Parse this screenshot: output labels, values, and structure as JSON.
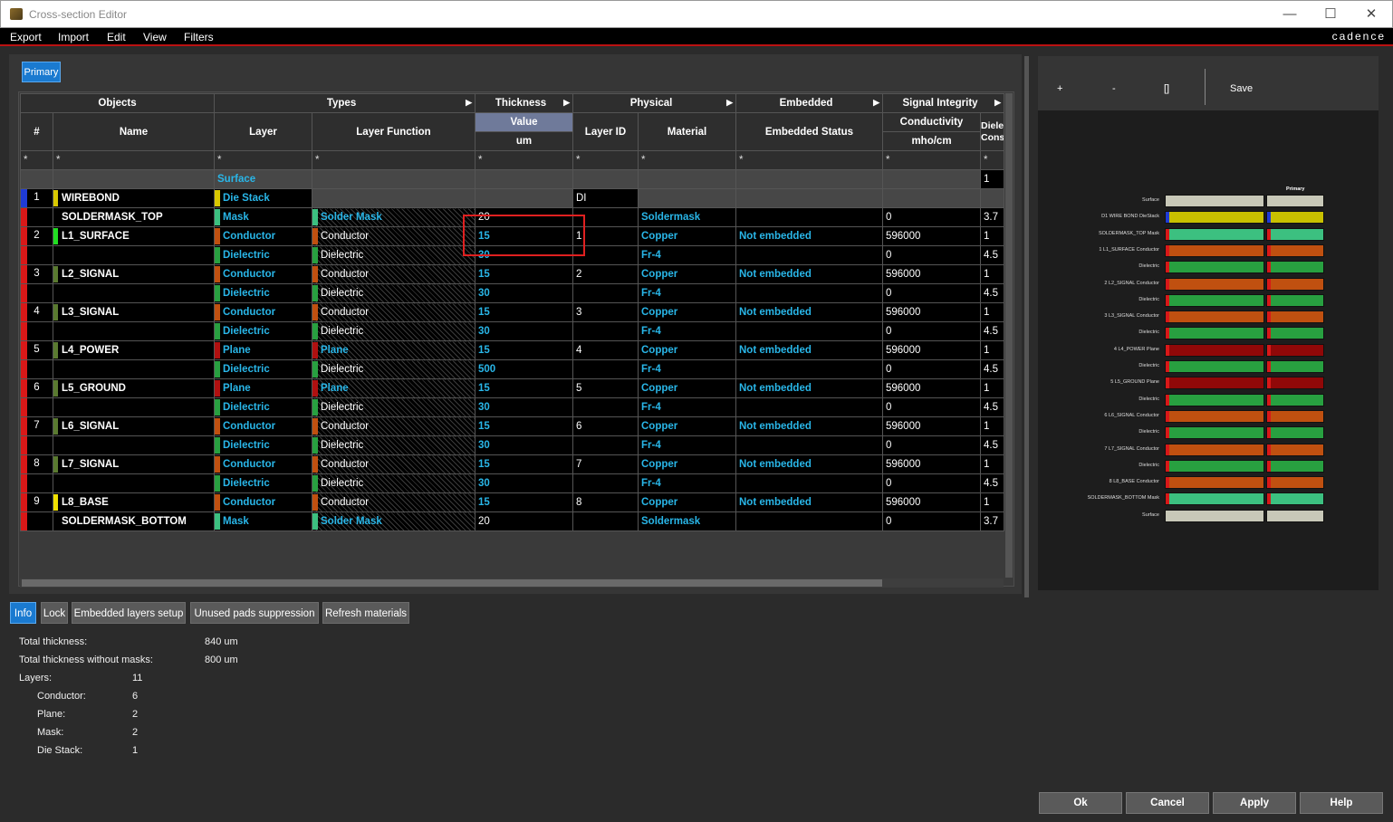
{
  "window": {
    "title": "Cross-section Editor",
    "minimize": "—",
    "maximize": "☐",
    "close": "✕"
  },
  "menu": {
    "items": [
      "Export",
      "Import",
      "Edit",
      "View",
      "Filters"
    ],
    "brand": "cadence"
  },
  "tabs": {
    "primary": "Primary"
  },
  "grid": {
    "groups": {
      "objects": "Objects",
      "types": "Types",
      "thickness": "Thickness",
      "physical": "Physical",
      "embedded": "Embedded",
      "signal_integrity": "Signal Integrity"
    },
    "columns": {
      "num": "#",
      "name": "Name",
      "layer": "Layer",
      "layer_function": "Layer Function",
      "value": "Value",
      "unit": "um",
      "layer_id": "Layer ID",
      "material": "Material",
      "embedded_status": "Embedded Status",
      "conductivity": "Conductivity",
      "conductivity_unit": "mho/cm",
      "dielectric_constant": "Dielect Consta"
    },
    "filter": "*",
    "rows": [
      {
        "num": "",
        "name": "",
        "layer": "Surface",
        "func": "",
        "thk": "",
        "id": "",
        "mat": "",
        "emb": "",
        "cond": "",
        "dk": "1",
        "style": "surface"
      },
      {
        "num": "1",
        "name": "WIREBOND",
        "layer": "Die Stack",
        "func": "",
        "thk": "",
        "id": "DI",
        "mat": "",
        "emb": "",
        "cond": "",
        "dk": "",
        "style": "die",
        "mark": "#1f3bd6",
        "lsw": "#d8c800"
      },
      {
        "num": "",
        "name": "SOLDERMASK_TOP",
        "layer": "Mask",
        "func": "Solder Mask",
        "thk": "20",
        "id": "",
        "mat": "Soldermask",
        "emb": "",
        "cond": "0",
        "dk": "3.7",
        "style": "mask",
        "mark": "#d81818"
      },
      {
        "num": "2",
        "name": "L1_SURFACE",
        "layer": "Conductor",
        "func": "Conductor",
        "thk": "15",
        "id": "1",
        "mat": "Copper",
        "emb": "Not embedded",
        "cond": "596000",
        "dk": "1",
        "style": "cond",
        "mark": "#d81818",
        "lsw": "#22dd22"
      },
      {
        "num": "",
        "name": "",
        "layer": "Dielectric",
        "func": "Dielectric",
        "thk": "30",
        "id": "",
        "mat": "Fr-4",
        "emb": "",
        "cond": "0",
        "dk": "4.5",
        "style": "diel",
        "mark": "#d81818"
      },
      {
        "num": "3",
        "name": "L2_SIGNAL",
        "layer": "Conductor",
        "func": "Conductor",
        "thk": "15",
        "id": "2",
        "mat": "Copper",
        "emb": "Not embedded",
        "cond": "596000",
        "dk": "1",
        "style": "cond",
        "mark": "#d81818",
        "lsw": "#5a7a30"
      },
      {
        "num": "",
        "name": "",
        "layer": "Dielectric",
        "func": "Dielectric",
        "thk": "30",
        "id": "",
        "mat": "Fr-4",
        "emb": "",
        "cond": "0",
        "dk": "4.5",
        "style": "diel",
        "mark": "#d81818"
      },
      {
        "num": "4",
        "name": "L3_SIGNAL",
        "layer": "Conductor",
        "func": "Conductor",
        "thk": "15",
        "id": "3",
        "mat": "Copper",
        "emb": "Not embedded",
        "cond": "596000",
        "dk": "1",
        "style": "cond",
        "mark": "#d81818",
        "lsw": "#5a7a30"
      },
      {
        "num": "",
        "name": "",
        "layer": "Dielectric",
        "func": "Dielectric",
        "thk": "30",
        "id": "",
        "mat": "Fr-4",
        "emb": "",
        "cond": "0",
        "dk": "4.5",
        "style": "diel",
        "mark": "#d81818"
      },
      {
        "num": "5",
        "name": "L4_POWER",
        "layer": "Plane",
        "func": "Plane",
        "thk": "15",
        "id": "4",
        "mat": "Copper",
        "emb": "Not embedded",
        "cond": "596000",
        "dk": "1",
        "style": "plane",
        "mark": "#d81818",
        "lsw": "#5a7a30"
      },
      {
        "num": "",
        "name": "",
        "layer": "Dielectric",
        "func": "Dielectric",
        "thk": "500",
        "id": "",
        "mat": "Fr-4",
        "emb": "",
        "cond": "0",
        "dk": "4.5",
        "style": "diel",
        "mark": "#d81818"
      },
      {
        "num": "6",
        "name": "L5_GROUND",
        "layer": "Plane",
        "func": "Plane",
        "thk": "15",
        "id": "5",
        "mat": "Copper",
        "emb": "Not embedded",
        "cond": "596000",
        "dk": "1",
        "style": "plane",
        "mark": "#d81818",
        "lsw": "#5a7a30"
      },
      {
        "num": "",
        "name": "",
        "layer": "Dielectric",
        "func": "Dielectric",
        "thk": "30",
        "id": "",
        "mat": "Fr-4",
        "emb": "",
        "cond": "0",
        "dk": "4.5",
        "style": "diel",
        "mark": "#d81818"
      },
      {
        "num": "7",
        "name": "L6_SIGNAL",
        "layer": "Conductor",
        "func": "Conductor",
        "thk": "15",
        "id": "6",
        "mat": "Copper",
        "emb": "Not embedded",
        "cond": "596000",
        "dk": "1",
        "style": "cond",
        "mark": "#d81818",
        "lsw": "#5a7a30"
      },
      {
        "num": "",
        "name": "",
        "layer": "Dielectric",
        "func": "Dielectric",
        "thk": "30",
        "id": "",
        "mat": "Fr-4",
        "emb": "",
        "cond": "0",
        "dk": "4.5",
        "style": "diel",
        "mark": "#d81818"
      },
      {
        "num": "8",
        "name": "L7_SIGNAL",
        "layer": "Conductor",
        "func": "Conductor",
        "thk": "15",
        "id": "7",
        "mat": "Copper",
        "emb": "Not embedded",
        "cond": "596000",
        "dk": "1",
        "style": "cond",
        "mark": "#d81818",
        "lsw": "#5a7a30"
      },
      {
        "num": "",
        "name": "",
        "layer": "Dielectric",
        "func": "Dielectric",
        "thk": "30",
        "id": "",
        "mat": "Fr-4",
        "emb": "",
        "cond": "0",
        "dk": "4.5",
        "style": "diel",
        "mark": "#d81818"
      },
      {
        "num": "9",
        "name": "L8_BASE",
        "layer": "Conductor",
        "func": "Conductor",
        "thk": "15",
        "id": "8",
        "mat": "Copper",
        "emb": "Not embedded",
        "cond": "596000",
        "dk": "1",
        "style": "cond",
        "mark": "#d81818",
        "lsw": "#f0e000"
      },
      {
        "num": "",
        "name": "SOLDERMASK_BOTTOM",
        "layer": "Mask",
        "func": "Solder Mask",
        "thk": "20",
        "id": "",
        "mat": "Soldermask",
        "emb": "",
        "cond": "0",
        "dk": "3.7",
        "style": "mask",
        "mark": "#d81818"
      }
    ]
  },
  "right_toolbar": {
    "zoom_in": "+",
    "zoom_out": "-",
    "fit": "[]",
    "save": "Save"
  },
  "preview": {
    "column_header": "Primary",
    "rows": [
      {
        "label": "Surface",
        "color": "#c8c8b8",
        "kind": "surface"
      },
      {
        "label": "D1   WIRE BOND DieStack",
        "color": "#c8c000",
        "kind": "die"
      },
      {
        "label": "SOLDERMASK_TOP Mask",
        "color": "#3cc080",
        "kind": "mask"
      },
      {
        "label": "1   L1_SURFACE Conductor",
        "color": "#c05010",
        "kind": "cond"
      },
      {
        "label": "Dielectric",
        "color": "#28a040",
        "kind": "diel"
      },
      {
        "label": "2   L2_SIGNAL Conductor",
        "color": "#c05010",
        "kind": "cond"
      },
      {
        "label": "Dielectric",
        "color": "#28a040",
        "kind": "diel"
      },
      {
        "label": "3   L3_SIGNAL Conductor",
        "color": "#c05010",
        "kind": "cond"
      },
      {
        "label": "Dielectric",
        "color": "#28a040",
        "kind": "diel"
      },
      {
        "label": "4   L4_POWER Plane",
        "color": "#900808",
        "kind": "plane"
      },
      {
        "label": "Dielectric",
        "color": "#28a040",
        "kind": "diel"
      },
      {
        "label": "5   L5_GROUND Plane",
        "color": "#900808",
        "kind": "plane"
      },
      {
        "label": "Dielectric",
        "color": "#28a040",
        "kind": "diel"
      },
      {
        "label": "6   L6_SIGNAL Conductor",
        "color": "#c05010",
        "kind": "cond"
      },
      {
        "label": "Dielectric",
        "color": "#28a040",
        "kind": "diel"
      },
      {
        "label": "7   L7_SIGNAL Conductor",
        "color": "#c05010",
        "kind": "cond"
      },
      {
        "label": "Dielectric",
        "color": "#28a040",
        "kind": "diel"
      },
      {
        "label": "8   L8_BASE Conductor",
        "color": "#c05010",
        "kind": "cond"
      },
      {
        "label": "SOLDERMASK_BOTTOM Mask",
        "color": "#3cc080",
        "kind": "mask"
      },
      {
        "label": "Surface",
        "color": "#c8c8b8",
        "kind": "surface"
      }
    ]
  },
  "bottom_tabs": [
    "Info",
    "Lock",
    "Embedded layers setup",
    "Unused pads suppression",
    "Refresh materials"
  ],
  "info": {
    "total_thickness_label": "Total thickness:",
    "total_thickness": "840 um",
    "total_no_mask_label": "Total thickness without masks:",
    "total_no_mask": "800 um",
    "layers_label": "Layers:",
    "layers": "11",
    "conductor_label": "Conductor:",
    "conductor": "6",
    "plane_label": "Plane:",
    "plane": "2",
    "mask_label": "Mask:",
    "mask": "2",
    "diestack_label": "Die Stack:",
    "diestack": "1"
  },
  "buttons": {
    "ok": "Ok",
    "cancel": "Cancel",
    "apply": "Apply",
    "help": "Help"
  },
  "colors": {
    "accent": "#1a7ad0",
    "link_text": "#29b6e8",
    "highlight": "#e02020",
    "value_header": "#6f7a9a"
  }
}
